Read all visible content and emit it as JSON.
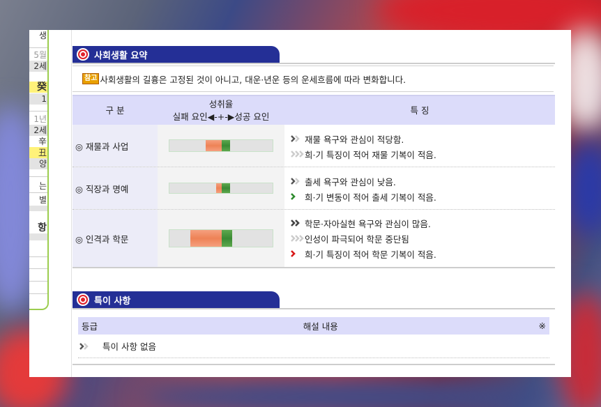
{
  "left_panel": {
    "rows": [
      "생",
      "5월",
      "2세",
      "癸",
      "1",
      "1년",
      "2세",
      "辛",
      "丑",
      "양",
      "는",
      "별",
      "항"
    ]
  },
  "summary": {
    "title": "사회생활 요약",
    "note_badge": "참고",
    "note_text": "사회생활의 길흉은 고정된 것이 아니고, 대운·년운 등의 운세흐름에 따라 변화합니다.",
    "headers": {
      "category": "구 분",
      "achievement_top": "성취율",
      "achievement_bottom": "실패 요인◀-+-▶성공 요인",
      "features": "특 징"
    },
    "rows": [
      {
        "category": "◎ 재물과 사업",
        "gauge": {
          "fail": 0.15,
          "success": 0.08
        },
        "features": [
          {
            "icon": "double-chevron-dark-icon",
            "text": "재물 욕구와 관심이 적당함."
          },
          {
            "icon": "triple-chevron-light-icon",
            "text": "희·기 특징이 적어 재물 기복이 적음."
          }
        ]
      },
      {
        "category": "◎ 직장과 명예",
        "gauge": {
          "fail": 0.05,
          "success": 0.08
        },
        "features": [
          {
            "icon": "double-chevron-dark-icon",
            "text": "출세 욕구와 관심이 낮음."
          },
          {
            "icon": "chevron-green-icon",
            "text": "희·기 변동이 적어 출세 기복이 적음."
          }
        ]
      },
      {
        "category": "◎ 인격과 학문",
        "gauge": {
          "fail": 0.3,
          "success": 0.1
        },
        "features": [
          {
            "icon": "double-chevron-heavy-icon",
            "text": "학문·자아실현 욕구와 관심이 많음."
          },
          {
            "icon": "triple-chevron-light-icon",
            "text": "인성이 파극되어 학문 중단됨"
          },
          {
            "icon": "chevron-red-icon",
            "text": "희·기 특징이 적어 학문 기복이 적음."
          }
        ]
      }
    ]
  },
  "special": {
    "title": "특이 사항",
    "headers": {
      "grade": "등급",
      "content": "해설 내용",
      "mark": "※"
    },
    "rows": [
      {
        "icon": "double-chevron-dark-icon",
        "text": "특이 사항 없음"
      }
    ]
  },
  "colors": {
    "header_bg": "#242f96",
    "table_header_bg": "#dcdcfa",
    "fail_color": "#f08a65",
    "success_color": "#3a8a34",
    "panel_border": "#9ccd4f"
  }
}
